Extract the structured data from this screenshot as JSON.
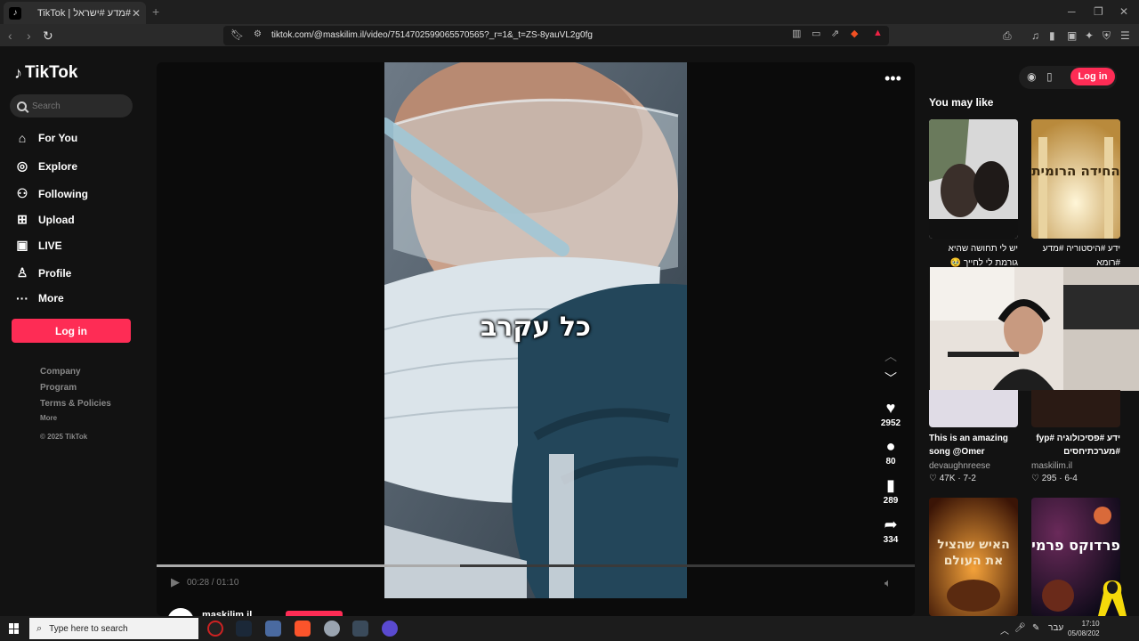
{
  "browser": {
    "tab_title": "TikTok | ידע #מדע #ישראל #",
    "tab_close": "✕",
    "new_tab": "+",
    "url": "tiktok.com/@maskilim.il/video/7514702599065570565?_r=1&_t=ZS-8yauVL2g0fg"
  },
  "sidebar": {
    "logo_text": "TikTok",
    "search_placeholder": "Search",
    "nav": [
      {
        "label": "For You",
        "icon": "home-icon"
      },
      {
        "label": "Explore",
        "icon": "compass-icon"
      },
      {
        "label": "Following",
        "icon": "people-icon"
      },
      {
        "label": "Upload",
        "icon": "plus-box-icon"
      },
      {
        "label": "LIVE",
        "icon": "live-tv-icon"
      },
      {
        "label": "Profile",
        "icon": "person-icon"
      },
      {
        "label": "More",
        "icon": "more-dots-icon"
      }
    ],
    "login_label": "Log in",
    "footer": {
      "company": "Company",
      "program": "Program",
      "terms": "Terms & Policies",
      "more": "More",
      "copyright": "© 2025 TikTok"
    }
  },
  "player": {
    "caption_overlay": "כל עקרב",
    "likes": "2952",
    "comments": "80",
    "saves": "289",
    "shares": "334",
    "time": "00:28 / 01:10",
    "progress": 0.4,
    "author": "maskilim.il"
  },
  "right": {
    "login_label": "Log in",
    "section_title": "You may like",
    "videos": [
      {
        "caption": "יש לי תחושה שהיא גורמת לי לחייך 🥹 #האחבדוגל",
        "author": "",
        "likes": "",
        "date": ""
      },
      {
        "caption": "ידע #היסטוריה #מדע #רומא",
        "author": "",
        "likes": "",
        "date": "",
        "thumb_text": "החידה הרומית"
      },
      {
        "caption": "This is an amazing song @Omer Adam...",
        "author": "devaughnreese",
        "likes": "47K",
        "date": "7-2"
      },
      {
        "caption": "ידע #פסיכולוגיה #fyp #מערכתיחסים",
        "author": "maskilim.il",
        "likes": "295",
        "date": "6-4"
      },
      {
        "caption": "",
        "author": "",
        "likes": "",
        "date": "",
        "thumb_text": "האיש שהציל את העולם"
      },
      {
        "caption": "",
        "author": "",
        "likes": "",
        "date": "",
        "thumb_text": "פרדוקס פרמי"
      }
    ]
  },
  "taskbar": {
    "search_placeholder": "Type here to search",
    "lang": "עבר",
    "time": "17:10",
    "date": "05/08/202"
  },
  "colors": {
    "accent": "#fe2c55",
    "background": "#121212"
  }
}
